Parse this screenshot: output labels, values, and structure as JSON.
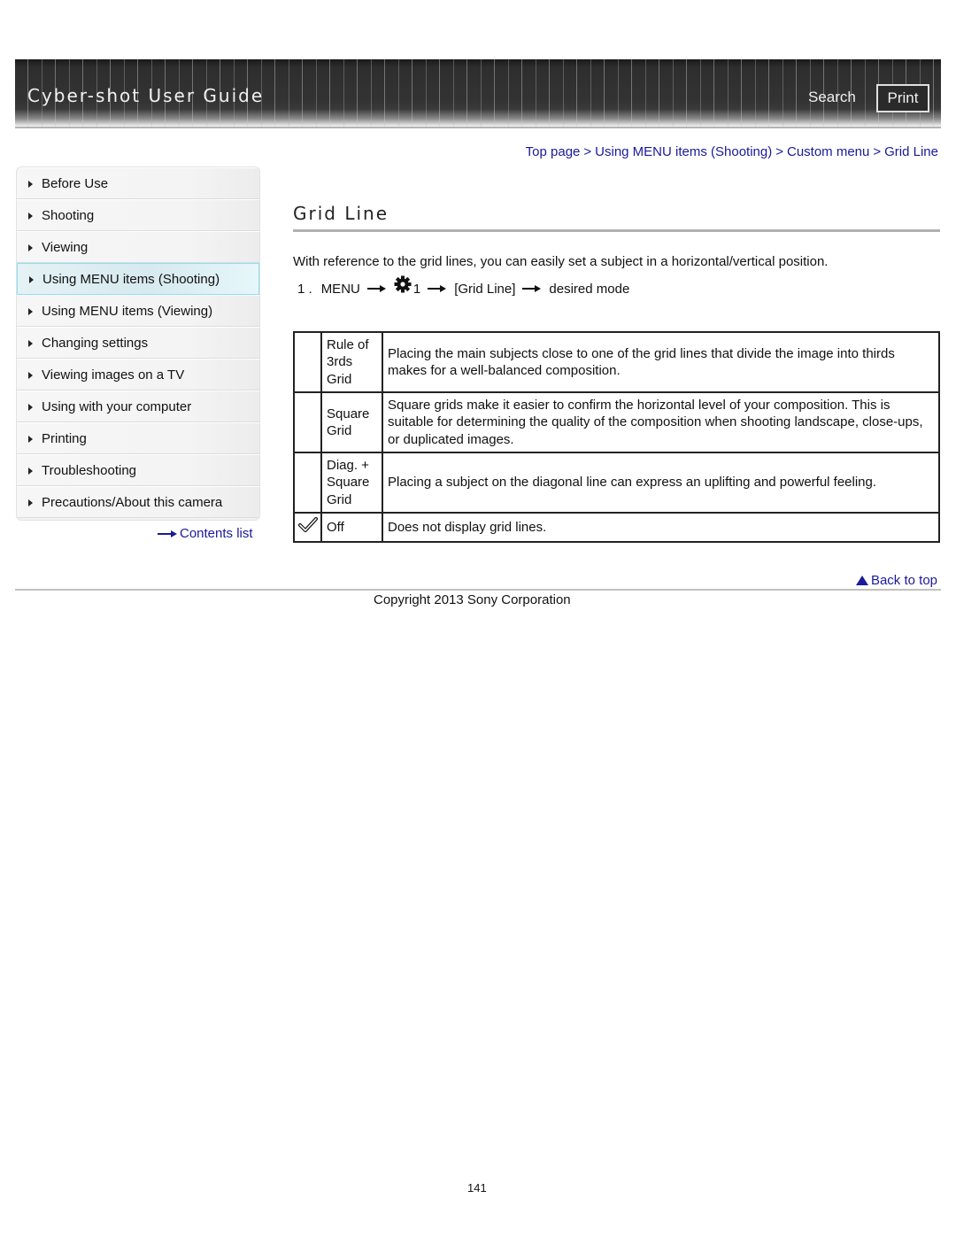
{
  "header": {
    "title": "Cyber-shot User Guide",
    "search_label": "Search",
    "print_label": "Print"
  },
  "breadcrumb": {
    "items": [
      "Top page",
      "Using MENU items (Shooting)",
      "Custom menu",
      "Grid Line"
    ],
    "separator": ">"
  },
  "sidebar": {
    "items": [
      {
        "label": "Before Use",
        "active": false
      },
      {
        "label": "Shooting",
        "active": false
      },
      {
        "label": "Viewing",
        "active": false
      },
      {
        "label": "Using MENU items (Shooting)",
        "active": true
      },
      {
        "label": "Using MENU items (Viewing)",
        "active": false
      },
      {
        "label": "Changing settings",
        "active": false
      },
      {
        "label": "Viewing images on a TV",
        "active": false
      },
      {
        "label": "Using with your computer",
        "active": false
      },
      {
        "label": "Printing",
        "active": false
      },
      {
        "label": "Troubleshooting",
        "active": false
      },
      {
        "label": "Precautions/About this camera",
        "active": false
      }
    ],
    "contents_link": "Contents list"
  },
  "main": {
    "title": "Grid Line",
    "intro": "With reference to the grid lines, you can easily set a subject in a horizontal/vertical position.",
    "step": {
      "number": "1 .",
      "menu": "MENU",
      "icon": "settings-gear-icon",
      "tab": "1",
      "item": "[Grid Line]",
      "target": "desired mode"
    },
    "modes": [
      {
        "checked": false,
        "name_lines": [
          "Rule of",
          "3rds",
          "Grid"
        ],
        "description": "Placing the main subjects close to one of the grid lines that divide the image into thirds makes for a well-balanced composition."
      },
      {
        "checked": false,
        "name_lines": [
          "Square",
          "Grid"
        ],
        "description": "Square grids make it easier to confirm the horizontal level of your composition. This is suitable for determining the quality of the composition when shooting landscape, close-ups, or duplicated images."
      },
      {
        "checked": false,
        "name_lines": [
          "Diag. +",
          "Square",
          "Grid"
        ],
        "description": "Placing a subject on the diagonal line can express an uplifting and powerful feeling."
      },
      {
        "checked": true,
        "name_lines": [
          "Off"
        ],
        "description": "Does not display grid lines."
      }
    ]
  },
  "footer": {
    "back_to_top": "Back to top",
    "copyright": "Copyright 2013 Sony Corporation",
    "page_number": "141"
  },
  "colors": {
    "link": "#1a1a9a",
    "active_border": "#8ee0ef",
    "header_bg": "#333333"
  }
}
